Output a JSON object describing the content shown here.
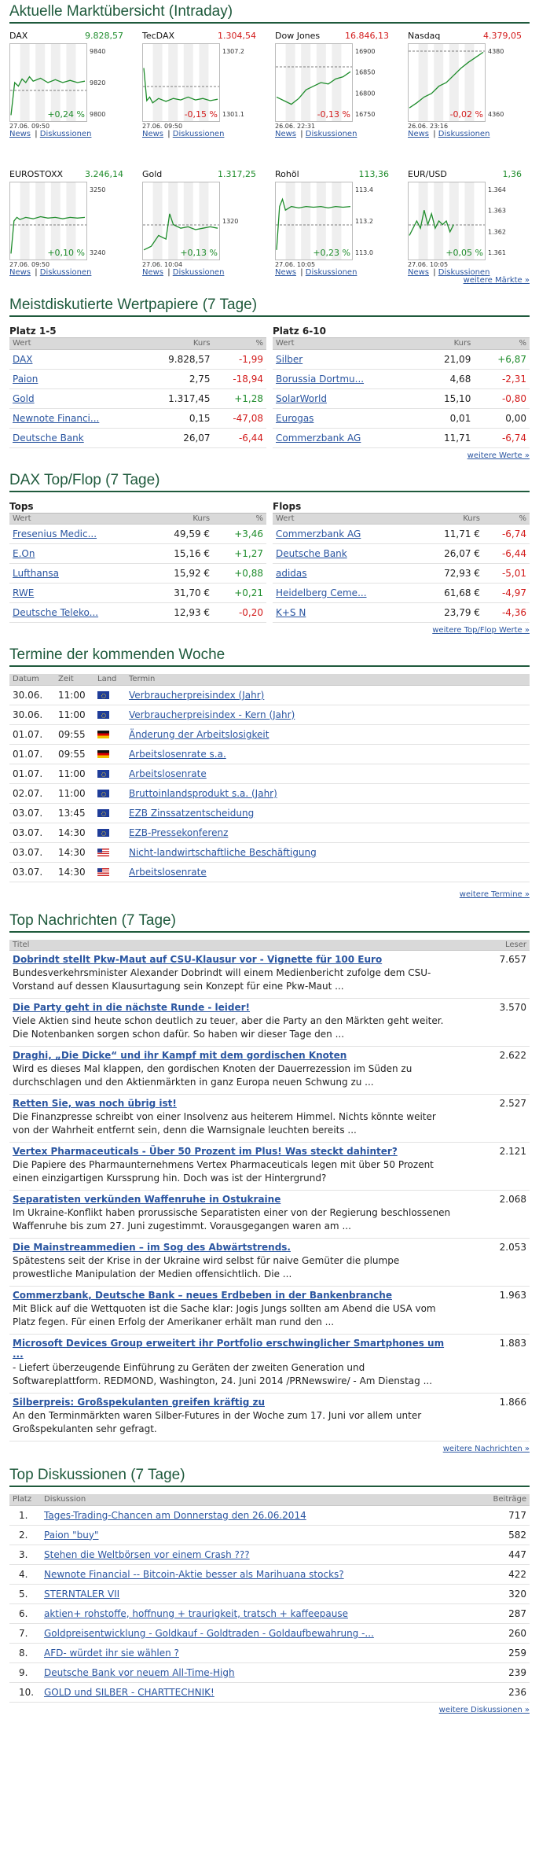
{
  "market": {
    "title": "Aktuelle Marktübersicht (Intraday)",
    "more": "weitere Märkte »",
    "news_link": "News",
    "disc_link": "Diskussionen",
    "tiles": [
      {
        "name": "DAX",
        "price": "9.828,57",
        "pc": "pos",
        "change": "+0,24 %",
        "cc": "pos",
        "ticks": [
          "9840",
          "9820",
          "9800"
        ],
        "dates": "27.06.  09:50",
        "pts": [
          [
            0,
            0.95
          ],
          [
            0.05,
            0.5
          ],
          [
            0.1,
            0.55
          ],
          [
            0.15,
            0.45
          ],
          [
            0.2,
            0.5
          ],
          [
            0.25,
            0.42
          ],
          [
            0.3,
            0.48
          ],
          [
            0.4,
            0.44
          ],
          [
            0.5,
            0.5
          ],
          [
            0.6,
            0.46
          ],
          [
            0.7,
            0.5
          ],
          [
            0.8,
            0.47
          ],
          [
            0.9,
            0.5
          ],
          [
            1,
            0.48
          ]
        ],
        "ref": 0.6
      },
      {
        "name": "TecDAX",
        "price": "1.304,54",
        "pc": "neg",
        "change": "-0,15 %",
        "cc": "neg",
        "ticks": [
          "1307.2",
          "1301.1"
        ],
        "dates": "27.06.  09:50",
        "pts": [
          [
            0,
            0.3
          ],
          [
            0.04,
            0.75
          ],
          [
            0.08,
            0.7
          ],
          [
            0.12,
            0.78
          ],
          [
            0.2,
            0.72
          ],
          [
            0.3,
            0.76
          ],
          [
            0.4,
            0.72
          ],
          [
            0.5,
            0.74
          ],
          [
            0.6,
            0.7
          ],
          [
            0.7,
            0.74
          ],
          [
            0.8,
            0.72
          ],
          [
            0.9,
            0.75
          ],
          [
            1,
            0.73
          ]
        ],
        "ref": 0.55
      },
      {
        "name": "Dow Jones",
        "price": "16.846,13",
        "pc": "neg",
        "change": "-0,13 %",
        "cc": "neg",
        "ticks": [
          "16900",
          "16850",
          "16800",
          "16750"
        ],
        "dates": "26.06.  22:31",
        "pts": [
          [
            0,
            0.7
          ],
          [
            0.1,
            0.75
          ],
          [
            0.2,
            0.8
          ],
          [
            0.3,
            0.72
          ],
          [
            0.4,
            0.6
          ],
          [
            0.5,
            0.55
          ],
          [
            0.6,
            0.5
          ],
          [
            0.7,
            0.52
          ],
          [
            0.8,
            0.45
          ],
          [
            0.9,
            0.42
          ],
          [
            1,
            0.35
          ]
        ],
        "ref": 0.3
      },
      {
        "name": "Nasdaq",
        "price": "4.379,05",
        "pc": "neg",
        "change": "-0,02 %",
        "cc": "neg",
        "ticks": [
          "4380",
          "4360"
        ],
        "dates": "26.06.  23:16",
        "pts": [
          [
            0,
            0.85
          ],
          [
            0.1,
            0.78
          ],
          [
            0.2,
            0.7
          ],
          [
            0.3,
            0.65
          ],
          [
            0.4,
            0.55
          ],
          [
            0.5,
            0.5
          ],
          [
            0.6,
            0.4
          ],
          [
            0.7,
            0.3
          ],
          [
            0.8,
            0.22
          ],
          [
            0.9,
            0.15
          ],
          [
            1,
            0.08
          ]
        ],
        "ref": 0.1
      },
      {
        "name": "EUROSTOXX",
        "price": "3.246,14",
        "pc": "pos",
        "change": "+0,10 %",
        "cc": "pos",
        "ticks": [
          "3250",
          "3240"
        ],
        "dates": "27.06.  09:50",
        "pts": [
          [
            0,
            0.95
          ],
          [
            0.04,
            0.5
          ],
          [
            0.08,
            0.45
          ],
          [
            0.12,
            0.48
          ],
          [
            0.2,
            0.45
          ],
          [
            0.3,
            0.47
          ],
          [
            0.4,
            0.44
          ],
          [
            0.5,
            0.46
          ],
          [
            0.6,
            0.45
          ],
          [
            0.7,
            0.47
          ],
          [
            0.8,
            0.45
          ],
          [
            0.9,
            0.46
          ],
          [
            1,
            0.45
          ]
        ],
        "ref": 0.55
      },
      {
        "name": "Gold",
        "price": "1.317,25",
        "pc": "pos",
        "change": "+0,13 %",
        "cc": "pos",
        "ticks": [
          "1320"
        ],
        "dates": "27.06.  10:04",
        "pts": [
          [
            0,
            0.9
          ],
          [
            0.1,
            0.85
          ],
          [
            0.2,
            0.7
          ],
          [
            0.3,
            0.75
          ],
          [
            0.35,
            0.4
          ],
          [
            0.4,
            0.55
          ],
          [
            0.5,
            0.6
          ],
          [
            0.6,
            0.58
          ],
          [
            0.7,
            0.62
          ],
          [
            0.8,
            0.6
          ],
          [
            0.9,
            0.58
          ],
          [
            1,
            0.6
          ]
        ],
        "ref": 0.55
      },
      {
        "name": "Rohöl",
        "price": "113,36",
        "pc": "pos",
        "change": "+0,23 %",
        "cc": "pos",
        "ticks": [
          "113.4",
          "113.2",
          "113.0"
        ],
        "dates": "27.06.  10:05",
        "pts": [
          [
            0,
            0.9
          ],
          [
            0.04,
            0.3
          ],
          [
            0.08,
            0.2
          ],
          [
            0.12,
            0.35
          ],
          [
            0.2,
            0.3
          ],
          [
            0.3,
            0.32
          ],
          [
            0.4,
            0.3
          ],
          [
            0.5,
            0.31
          ],
          [
            0.6,
            0.3
          ],
          [
            0.7,
            0.32
          ],
          [
            0.8,
            0.3
          ],
          [
            0.9,
            0.31
          ],
          [
            1,
            0.3
          ]
        ],
        "ref": 0.55
      },
      {
        "name": "EUR/USD",
        "price": "1,36",
        "pc": "pos",
        "change": "+0,05 %",
        "cc": "pos",
        "ticks": [
          "1.364",
          "1.363",
          "1.362",
          "1.361"
        ],
        "dates": "27.06.  10:05",
        "pts": [
          [
            0,
            0.7
          ],
          [
            0.1,
            0.5
          ],
          [
            0.15,
            0.6
          ],
          [
            0.2,
            0.35
          ],
          [
            0.25,
            0.55
          ],
          [
            0.3,
            0.4
          ],
          [
            0.35,
            0.6
          ],
          [
            0.4,
            0.5
          ],
          [
            0.45,
            0.55
          ],
          [
            0.5,
            0.5
          ],
          [
            0.55,
            0.65
          ],
          [
            0.6,
            0.55
          ]
        ],
        "ref": 0.55
      }
    ]
  },
  "most": {
    "title": "Meistdiskutierte Wertpapiere (7 Tage)",
    "more": "weitere Werte »",
    "h_wert": "Wert",
    "h_kurs": "Kurs",
    "h_pct": "%",
    "left": {
      "sub": "Platz 1-5",
      "rows": [
        {
          "n": "DAX",
          "k": "9.828,57",
          "p": "-1,99",
          "c": "neg"
        },
        {
          "n": "Paion",
          "k": "2,75",
          "p": "-18,94",
          "c": "neg"
        },
        {
          "n": "Gold",
          "k": "1.317,45",
          "p": "+1,28",
          "c": "pos"
        },
        {
          "n": "Newnote Financi...",
          "k": "0,15",
          "p": "-47,08",
          "c": "neg"
        },
        {
          "n": "Deutsche Bank",
          "k": "26,07",
          "p": "-6,44",
          "c": "neg"
        }
      ]
    },
    "right": {
      "sub": "Platz 6-10",
      "rows": [
        {
          "n": "Silber",
          "k": "21,09",
          "p": "+6,87",
          "c": "pos"
        },
        {
          "n": "Borussia Dortmu...",
          "k": "4,68",
          "p": "-2,31",
          "c": "neg"
        },
        {
          "n": "SolarWorld",
          "k": "15,10",
          "p": "-0,80",
          "c": "neg"
        },
        {
          "n": "Eurogas",
          "k": "0,01",
          "p": "0,00",
          "c": "zero"
        },
        {
          "n": "Commerzbank AG",
          "k": "11,71",
          "p": "-6,74",
          "c": "neg"
        }
      ]
    }
  },
  "dax": {
    "title": "DAX Top/Flop (7 Tage)",
    "more": "weitere Top/Flop Werte »",
    "left": {
      "sub": "Tops",
      "rows": [
        {
          "n": "Fresenius Medic...",
          "k": "49,59 €",
          "p": "+3,46",
          "c": "pos"
        },
        {
          "n": "E.On",
          "k": "15,16 €",
          "p": "+1,27",
          "c": "pos"
        },
        {
          "n": "Lufthansa",
          "k": "15,92 €",
          "p": "+0,88",
          "c": "pos"
        },
        {
          "n": "RWE",
          "k": "31,70 €",
          "p": "+0,21",
          "c": "pos"
        },
        {
          "n": "Deutsche Teleko...",
          "k": "12,93 €",
          "p": "-0,20",
          "c": "neg"
        }
      ]
    },
    "right": {
      "sub": "Flops",
      "rows": [
        {
          "n": "Commerzbank AG",
          "k": "11,71 €",
          "p": "-6,74",
          "c": "neg"
        },
        {
          "n": "Deutsche Bank",
          "k": "26,07 €",
          "p": "-6,44",
          "c": "neg"
        },
        {
          "n": "adidas",
          "k": "72,93 €",
          "p": "-5,01",
          "c": "neg"
        },
        {
          "n": "Heidelberg Ceme...",
          "k": "61,68 €",
          "p": "-4,97",
          "c": "neg"
        },
        {
          "n": "K+S N",
          "k": "23,79 €",
          "p": "-4,36",
          "c": "neg"
        }
      ]
    }
  },
  "termine": {
    "title": "Termine der kommenden Woche",
    "more": "weitere Termine »",
    "h": [
      "Datum",
      "Zeit",
      "Land",
      "Termin"
    ],
    "rows": [
      {
        "d": "30.06.",
        "z": "11:00",
        "f": "eu",
        "t": "Verbraucherpreisindex (Jahr)"
      },
      {
        "d": "30.06.",
        "z": "11:00",
        "f": "eu",
        "t": "Verbraucherpreisindex - Kern (Jahr)"
      },
      {
        "d": "01.07.",
        "z": "09:55",
        "f": "de",
        "t": "Änderung der Arbeitslosigkeit"
      },
      {
        "d": "01.07.",
        "z": "09:55",
        "f": "de",
        "t": "Arbeitslosenrate s.a."
      },
      {
        "d": "01.07.",
        "z": "11:00",
        "f": "eu",
        "t": "Arbeitslosenrate"
      },
      {
        "d": "02.07.",
        "z": "11:00",
        "f": "eu",
        "t": "Bruttoinlandsprodukt s.a. (Jahr)"
      },
      {
        "d": "03.07.",
        "z": "13:45",
        "f": "eu",
        "t": "EZB Zinssatzentscheidung"
      },
      {
        "d": "03.07.",
        "z": "14:30",
        "f": "eu",
        "t": "EZB-Pressekonferenz"
      },
      {
        "d": "03.07.",
        "z": "14:30",
        "f": "us",
        "t": "Nicht-landwirtschaftliche Beschäftigung"
      },
      {
        "d": "03.07.",
        "z": "14:30",
        "f": "us",
        "t": "Arbeitslosenrate"
      }
    ]
  },
  "news": {
    "title": "Top Nachrichten (7 Tage)",
    "more": "weitere Nachrichten »",
    "h_titel": "Titel",
    "h_leser": "Leser",
    "rows": [
      {
        "t": "Dobrindt stellt Pkw-Maut auf CSU-Klausur vor - Vignette für 100 Euro",
        "x": "Bundesverkehrsminister Alexander Dobrindt will einem Medienbericht zufolge dem CSU-Vorstand auf dessen Klausurtagung sein Konzept für eine Pkw-Maut ...",
        "l": "7.657"
      },
      {
        "t": "Die Party geht in die nächste Runde - leider!",
        "x": "Viele Aktien sind heute schon deutlich zu teuer, aber die Party an den Märkten geht weiter. Die Notenbanken sorgen schon dafür. So haben wir dieser Tage den ...",
        "l": "3.570"
      },
      {
        "t": "Draghi, „Die Dicke“ und ihr Kampf mit dem gordischen Knoten",
        "x": "Wird es dieses Mal klappen, den gordischen Knoten der Dauerrezession im Süden zu durchschlagen und den Aktienmärkten in ganz Europa neuen Schwung zu ...",
        "l": "2.622"
      },
      {
        "t": "Retten Sie, was noch übrig ist!",
        "x": "Die Finanzpresse schreibt von einer Insolvenz aus heiterem Himmel. Nichts könnte weiter von der Wahrheit entfernt sein, denn die Warnsignale leuchten bereits ...",
        "l": "2.527"
      },
      {
        "t": "Vertex Pharmaceuticals - Über 50 Prozent im Plus! Was steckt dahinter?",
        "x": "Die Papiere des Pharmaunternehmens Vertex Pharmaceuticals legen mit über 50 Prozent einen einzigartigen Kurssprung hin. Doch was ist der Hintergrund?",
        "l": "2.121"
      },
      {
        "t": "Separatisten verkünden Waffenruhe in Ostukraine",
        "x": "Im Ukraine-Konflikt haben prorussische Separatisten einer von der Regierung beschlossenen Waffenruhe bis zum 27. Juni zugestimmt. Vorausgegangen waren am ...",
        "l": "2.068"
      },
      {
        "t": "Die Mainstreammedien – im Sog des Abwärtstrends.",
        "x": "Spätestens seit der Krise in der Ukraine wird selbst für naive Gemüter die plumpe prowestliche Manipulation der Medien offensichtlich. Die ...",
        "l": "2.053"
      },
      {
        "t": "Commerzbank, Deutsche Bank – neues Erdbeben in der Bankenbranche",
        "x": "Mit Blick auf die Wettquoten ist die Sache klar: Jogis Jungs sollten am Abend die USA vom Platz fegen. Für einen Erfolg der Amerikaner erhält man rund den ...",
        "l": "1.963"
      },
      {
        "t": "Microsoft Devices Group erweitert ihr Portfolio erschwinglicher Smartphones um ...",
        "x": "- Liefert überzeugende Einführung zu Geräten der zweiten Generation und Softwareplattform. REDMOND, Washington, 24. Juni 2014 /PRNewswire/ - Am Dienstag ...",
        "l": "1.883"
      },
      {
        "t": "Silberpreis: Großspekulanten greifen kräftig zu",
        "x": "An den Terminmärkten waren Silber-Futures in der Woche zum 17. Juni vor allem unter Großspekulanten sehr gefragt.",
        "l": "1.866"
      }
    ]
  },
  "disc": {
    "title": "Top Diskussionen (7 Tage)",
    "more": "weitere Diskussionen »",
    "h": [
      "Platz",
      "Diskussion",
      "Beiträge"
    ],
    "rows": [
      {
        "p": "1.",
        "t": "Tages-Trading-Chancen am Donnerstag den 26.06.2014",
        "b": "717"
      },
      {
        "p": "2.",
        "t": "Paion \"buy\"",
        "b": "582"
      },
      {
        "p": "3.",
        "t": "Stehen die Weltbörsen vor einem Crash ???",
        "b": "447"
      },
      {
        "p": "4.",
        "t": "Newnote Financial -- Bitcoin-Aktie besser als Marihuana stocks?",
        "b": "422"
      },
      {
        "p": "5.",
        "t": "STERNTALER VII",
        "b": "320"
      },
      {
        "p": "6.",
        "t": "aktien+ rohstoffe, hoffnung + traurigkeit, tratsch + kaffeepause",
        "b": "287"
      },
      {
        "p": "7.",
        "t": "Goldpreisentwicklung - Goldkauf - Goldtraden - Goldaufbewahrung -...",
        "b": "260"
      },
      {
        "p": "8.",
        "t": "AFD- würdet ihr sie wählen ?",
        "b": "259"
      },
      {
        "p": "9.",
        "t": "Deutsche Bank vor neuem All-Time-High",
        "b": "239"
      },
      {
        "p": "10.",
        "t": "GOLD und SILBER - CHARTTECHNIK!",
        "b": "236"
      }
    ]
  },
  "colors": {
    "pos": "#1e8c2b",
    "neg": "#d21a1a",
    "heading": "#1f5a3c",
    "link": "#2a55a0"
  }
}
